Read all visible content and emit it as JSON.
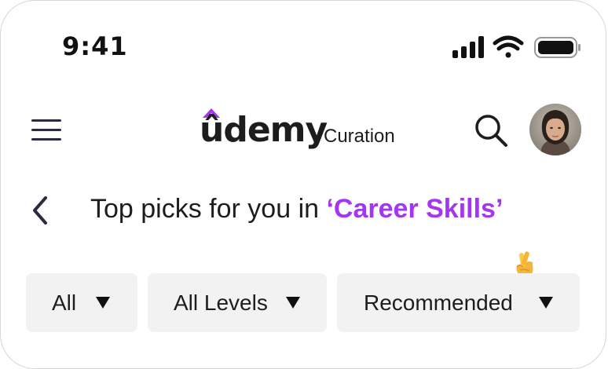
{
  "status_bar": {
    "time": "9:41",
    "icons": [
      "cellular-signal-icon",
      "wifi-icon",
      "battery-icon"
    ]
  },
  "header": {
    "menu_icon": "hamburger-menu-icon",
    "logo_text": "ûdemy",
    "logo_subtitle": "Curation",
    "search_icon": "search-icon",
    "avatar": "user-avatar"
  },
  "section": {
    "back_icon": "chevron-left-icon",
    "title_prefix": "Top picks for you in ",
    "title_highlight": "‘Career Skills’"
  },
  "filters": [
    {
      "label": "All"
    },
    {
      "label": "All Levels"
    },
    {
      "label": "Recommended"
    }
  ],
  "colors": {
    "accent": "#a435f0",
    "text": "#1c1d1f",
    "chip_bg": "#f2f2f2"
  }
}
